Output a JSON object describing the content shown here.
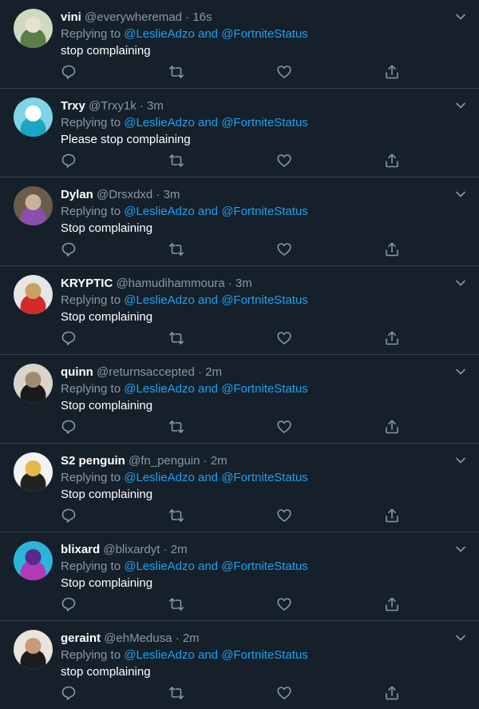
{
  "colors": {
    "background": "#15202b",
    "divider": "#38444d",
    "secondary_text": "#8899a6",
    "link": "#1da1f2",
    "primary_text": "#ffffff"
  },
  "tweets": [
    {
      "display_name": "vini",
      "handle": "@everywheremad",
      "separator": "·",
      "time": "16s",
      "replying_prefix": "Replying to",
      "mention1": "@LeslieAdzo",
      "conjunction": "and",
      "mention2": "@FortniteStatus",
      "text": "stop complaining",
      "avatar_colors": [
        "#cfd8c0",
        "#5a7d4a",
        "#e8e1d0"
      ]
    },
    {
      "display_name": "Trxy",
      "handle": "@Trxy1k",
      "separator": "·",
      "time": "3m",
      "replying_prefix": "Replying to",
      "mention1": "@LeslieAdzo",
      "conjunction": "and",
      "mention2": "@FortniteStatus",
      "text": "Please stop complaining",
      "avatar_colors": [
        "#7fd4e6",
        "#1aa6c4",
        "#ffffff"
      ]
    },
    {
      "display_name": "Dylan",
      "handle": "@Drsxdxd",
      "separator": "·",
      "time": "3m",
      "replying_prefix": "Replying to",
      "mention1": "@LeslieAdzo",
      "conjunction": "and",
      "mention2": "@FortniteStatus",
      "text": "Stop complaining",
      "avatar_colors": [
        "#6b5b4a",
        "#8a4fa8",
        "#c8b39a"
      ]
    },
    {
      "display_name": "KRYPTIC",
      "handle": "@hamudihammoura",
      "separator": "·",
      "time": "3m",
      "replying_prefix": "Replying to",
      "mention1": "@LeslieAdzo",
      "conjunction": "and",
      "mention2": "@FortniteStatus",
      "text": "Stop complaining",
      "avatar_colors": [
        "#e6e6e6",
        "#d42a2a",
        "#c9a063"
      ]
    },
    {
      "display_name": "quinn",
      "handle": "@returnsaccepted",
      "separator": "·",
      "time": "2m",
      "replying_prefix": "Replying to",
      "mention1": "@LeslieAdzo",
      "conjunction": "and",
      "mention2": "@FortniteStatus",
      "text": "Stop complaining",
      "avatar_colors": [
        "#d8d4cc",
        "#1a1a1a",
        "#a08a70"
      ]
    },
    {
      "display_name": "S2 penguin",
      "handle": "@fn_penguin",
      "separator": "·",
      "time": "2m",
      "replying_prefix": "Replying to",
      "mention1": "@LeslieAdzo",
      "conjunction": "and",
      "mention2": "@FortniteStatus",
      "text": "Stop complaining",
      "avatar_colors": [
        "#f2f2f2",
        "#222222",
        "#e6b84a"
      ]
    },
    {
      "display_name": "blixard",
      "handle": "@blixardyt",
      "separator": "·",
      "time": "2m",
      "replying_prefix": "Replying to",
      "mention1": "@LeslieAdzo",
      "conjunction": "and",
      "mention2": "@FortniteStatus",
      "text": "Stop complaining",
      "avatar_colors": [
        "#2bb5d8",
        "#b23ab8",
        "#5a2a8a"
      ]
    },
    {
      "display_name": "geraint",
      "handle": "@ehMedusa",
      "separator": "·",
      "time": "2m",
      "replying_prefix": "Replying to",
      "mention1": "@LeslieAdzo",
      "conjunction": "and",
      "mention2": "@FortniteStatus",
      "text": "stop complaining",
      "avatar_colors": [
        "#e9e4dc",
        "#1c1c1c",
        "#c99a78"
      ]
    }
  ],
  "icons": {
    "caret": "chevron-down-icon",
    "reply": "reply-icon",
    "retweet": "retweet-icon",
    "like": "like-icon",
    "share": "share-icon"
  }
}
